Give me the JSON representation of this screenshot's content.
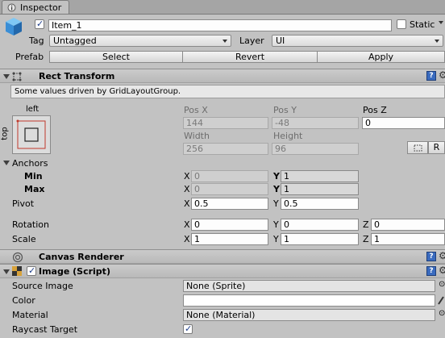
{
  "tab": {
    "title": "Inspector"
  },
  "header": {
    "object_name": "Item_1",
    "static_label": "Static",
    "tag_label": "Tag",
    "tag_value": "Untagged",
    "layer_label": "Layer",
    "layer_value": "UI",
    "prefab_label": "Prefab",
    "prefab_buttons": [
      "Select",
      "Revert",
      "Apply"
    ]
  },
  "rect_transform": {
    "title": "Rect Transform",
    "help": "Some values driven by GridLayoutGroup.",
    "anchor_h": "left",
    "anchor_v": "top",
    "pos_x_label": "Pos X",
    "pos_x": "144",
    "pos_y_label": "Pos Y",
    "pos_y": "-48",
    "pos_z_label": "Pos Z",
    "pos_z": "0",
    "width_label": "Width",
    "width": "256",
    "height_label": "Height",
    "height": "96",
    "r_button": "R",
    "anchors_label": "Anchors",
    "min_label": "Min",
    "min_x": "0",
    "min_y": "1",
    "max_label": "Max",
    "max_x": "0",
    "max_y": "1",
    "pivot_label": "Pivot",
    "pivot_x": "0.5",
    "pivot_y": "0.5",
    "rotation_label": "Rotation",
    "rot_x": "0",
    "rot_y": "0",
    "rot_z": "0",
    "scale_label": "Scale",
    "scale_x": "1",
    "scale_y": "1",
    "scale_z": "1",
    "x": "X",
    "y": "Y",
    "z": "Z"
  },
  "canvas_renderer": {
    "title": "Canvas Renderer"
  },
  "image": {
    "title": "Image (Script)",
    "source_image_label": "Source Image",
    "source_image": "None (Sprite)",
    "color_label": "Color",
    "material_label": "Material",
    "material": "None (Material)",
    "raycast_label": "Raycast Target"
  },
  "colors": {
    "header_blue": "#3a6bbf",
    "panel": "#c2c2c2"
  },
  "icons": [
    "inspector-icon",
    "cube-icon",
    "rect-transform-icon",
    "help-icon",
    "gear-icon",
    "canvas-renderer-icon",
    "image-script-icon",
    "eyedropper-icon",
    "object-picker-icon"
  ]
}
